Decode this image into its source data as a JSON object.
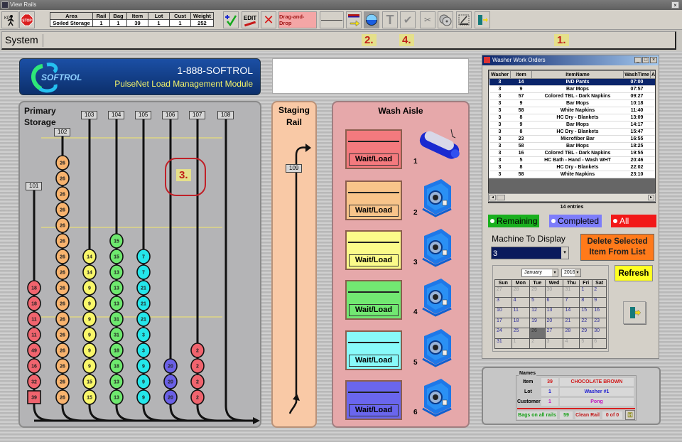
{
  "window": {
    "title": "View Rails",
    "close_icon": "close-icon"
  },
  "toolbar": {
    "info_headers": [
      "Area",
      "Rail",
      "Bag",
      "Item",
      "Lot",
      "Cust",
      "Weight"
    ],
    "info_values": [
      "Soiled Storage",
      "1",
      "1",
      "39",
      "1",
      "1",
      "252"
    ],
    "edit_label": "EDIT",
    "drag_drop_label": "Drag-and-Drop",
    "stop_label": "STOP"
  },
  "system_bar": {
    "label": "System"
  },
  "markers": {
    "m1": "1.",
    "m2": "2.",
    "m3": "3.",
    "m4": "4."
  },
  "banner": {
    "logo_text": "SOFTROL",
    "phone": "1-888-SOFTROL",
    "module": "PulseNet Load Management Module"
  },
  "primary_storage": {
    "title_line1": "Primary",
    "title_line2": "Storage",
    "rails": [
      {
        "id": "101",
        "color": "#f0646e",
        "bags": [
          "18",
          "18",
          "11",
          "11",
          "49",
          "16",
          "32",
          "39"
        ]
      },
      {
        "id": "102",
        "color": "#f8b36e",
        "bags": [
          "26",
          "26",
          "26",
          "26",
          "26",
          "26",
          "26",
          "26",
          "26",
          "26",
          "26",
          "26",
          "26",
          "26",
          "26",
          "26"
        ]
      },
      {
        "id": "103",
        "color": "#f9f76a",
        "bags": [
          "14",
          "14",
          "9",
          "9",
          "9",
          "9",
          "9",
          "9",
          "15",
          "15"
        ]
      },
      {
        "id": "104",
        "color": "#6ee86e",
        "bags": [
          "15",
          "15",
          "13",
          "13",
          "13",
          "31",
          "31",
          "18",
          "18",
          "13",
          "13"
        ]
      },
      {
        "id": "105",
        "color": "#24e6ea",
        "bags": [
          "7",
          "7",
          "21",
          "21",
          "21",
          "3",
          "3",
          "9",
          "9",
          "9"
        ]
      },
      {
        "id": "106",
        "color": "#6a60e6",
        "bags": [
          "20",
          "20",
          "20"
        ]
      },
      {
        "id": "107",
        "color": "#f0646e",
        "bags": [
          "2",
          "2",
          "2",
          "2"
        ]
      },
      {
        "id": "108",
        "color": "#000000",
        "bags": []
      }
    ]
  },
  "staging": {
    "title_line1": "Staging",
    "title_line2": "Rail",
    "rail_id": "109"
  },
  "wash_aisle": {
    "title": "Wash Aisle",
    "washers": [
      {
        "num": "1",
        "status": "Wait/Load",
        "color": "#f47a7e",
        "type": "tunnel"
      },
      {
        "num": "2",
        "status": "Wait/Load",
        "color": "#f8c48a",
        "type": "extractor"
      },
      {
        "num": "3",
        "status": "Wait/Load",
        "color": "#fbfb8a",
        "type": "extractor"
      },
      {
        "num": "4",
        "status": "Wait/Load",
        "color": "#72e872",
        "type": "extractor"
      },
      {
        "num": "5",
        "status": "Wait/Load",
        "color": "#88fafa",
        "type": "extractor"
      },
      {
        "num": "6",
        "status": "Wait/Load",
        "color": "#6a66ee",
        "type": "extractor"
      }
    ]
  },
  "work_orders": {
    "title": "Washer Work Orders",
    "columns": [
      "Washer",
      "Item",
      "ItemName",
      "WashTime",
      "A"
    ],
    "rows": [
      [
        "3",
        "14",
        "IND Pants",
        "07:00"
      ],
      [
        "3",
        "9",
        "Bar Mops",
        "07:57"
      ],
      [
        "3",
        "57",
        "Colored TBL - Dark Napkins",
        "09:27"
      ],
      [
        "3",
        "9",
        "Bar Mops",
        "10:18"
      ],
      [
        "3",
        "58",
        "White Napkins",
        "11:40"
      ],
      [
        "3",
        "8",
        "HC Dry - Blankets",
        "13:09"
      ],
      [
        "3",
        "9",
        "Bar Mops",
        "14:17"
      ],
      [
        "3",
        "8",
        "HC Dry - Blankets",
        "15:47"
      ],
      [
        "3",
        "23",
        "Microfiber Bar",
        "16:55"
      ],
      [
        "3",
        "58",
        "Bar Mops",
        "18:25"
      ],
      [
        "3",
        "16",
        "Colored TBL - Dark Napkins",
        "19:55"
      ],
      [
        "3",
        "5",
        "HC Bath - Hand - Wash WHT",
        "20:46"
      ],
      [
        "3",
        "8",
        "HC Dry - Blankets",
        "22:02"
      ],
      [
        "3",
        "58",
        "White Napkins",
        "23:10"
      ]
    ],
    "selected_row": 0,
    "entries": "14 entries",
    "filters": [
      {
        "label": "Remaining",
        "color": "#19b01e"
      },
      {
        "label": "Completed",
        "color": "#7d7dfa"
      },
      {
        "label": "All",
        "color": "#f21818"
      }
    ],
    "machine_label": "Machine To Display",
    "machine_value": "3",
    "delete_label_1": "Delete Selected",
    "delete_label_2": "Item From List",
    "refresh_label": "Refresh",
    "calendar": {
      "month": "January",
      "year": "2016",
      "days": [
        "Sun",
        "Mon",
        "Tue",
        "Wed",
        "Thu",
        "Fri",
        "Sat"
      ],
      "weeks": [
        [
          "27",
          "28",
          "29",
          "30",
          "31",
          "1",
          "2"
        ],
        [
          "3",
          "4",
          "5",
          "6",
          "7",
          "8",
          "9"
        ],
        [
          "10",
          "11",
          "12",
          "13",
          "14",
          "15",
          "16"
        ],
        [
          "17",
          "18",
          "19",
          "20",
          "21",
          "22",
          "23"
        ],
        [
          "24",
          "25",
          "26",
          "27",
          "28",
          "29",
          "30"
        ],
        [
          "31",
          "1",
          "2",
          "3",
          "4",
          "5",
          "6"
        ]
      ],
      "selected": "26"
    }
  },
  "names": {
    "legend": "Names",
    "item_label": "Item",
    "item_num": "39",
    "item_name": "CHOCOLATE BROWN NAPKINS",
    "lot_label": "Lot",
    "lot_num": "1",
    "lot_name": "Washer #1",
    "cust_label": "Customer",
    "cust_num": "1",
    "cust_name": "Pong",
    "bags_label": "Bags on all rails",
    "bags_count": "59",
    "clean_label": "Clean Rail",
    "clean_count": "0 of 0"
  }
}
